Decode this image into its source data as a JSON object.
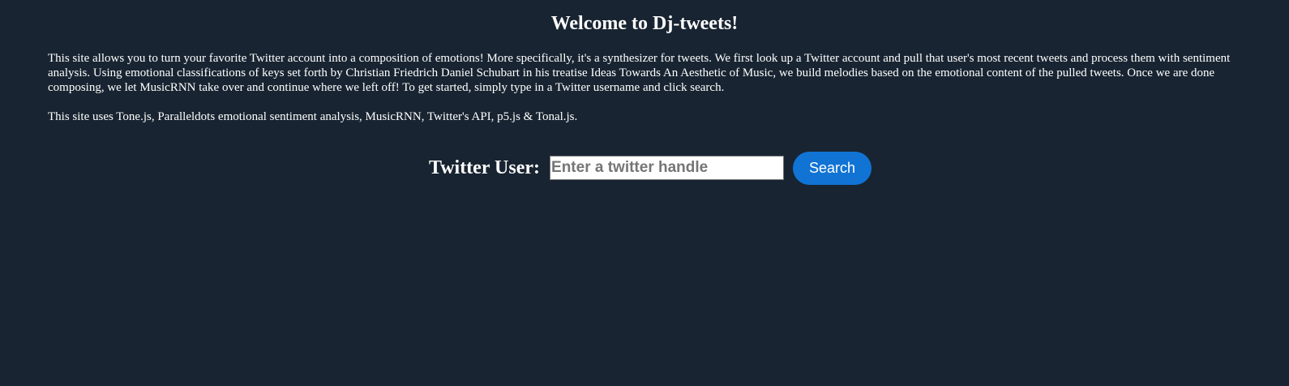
{
  "header": {
    "title": "Welcome to Dj-tweets!"
  },
  "main": {
    "intro": "This site allows you to turn your favorite Twitter account into a composition of emotions! More specifically, it's a synthesizer for tweets. We first look up a Twitter account and pull that user's most recent tweets and process them with sentiment analysis. Using emotional classifications of keys set forth by Christian Friedrich Daniel Schubart in his treatise Ideas Towards An Aesthetic of Music, we build melodies based on the emotional content of the pulled tweets. Once we are done composing, we let MusicRNN take over and continue where we left off! To get started, simply type in a Twitter username and click search.",
    "credits": "This site uses Tone.js, Paralleldots emotional sentiment analysis, MusicRNN, Twitter's API, p5.js & Tonal.js."
  },
  "search": {
    "label": "Twitter User:",
    "placeholder": "Enter a twitter handle",
    "value": "",
    "button_label": "Search"
  },
  "colors": {
    "background": "#182431",
    "button": "#1173d4",
    "text": "#ffffff"
  }
}
